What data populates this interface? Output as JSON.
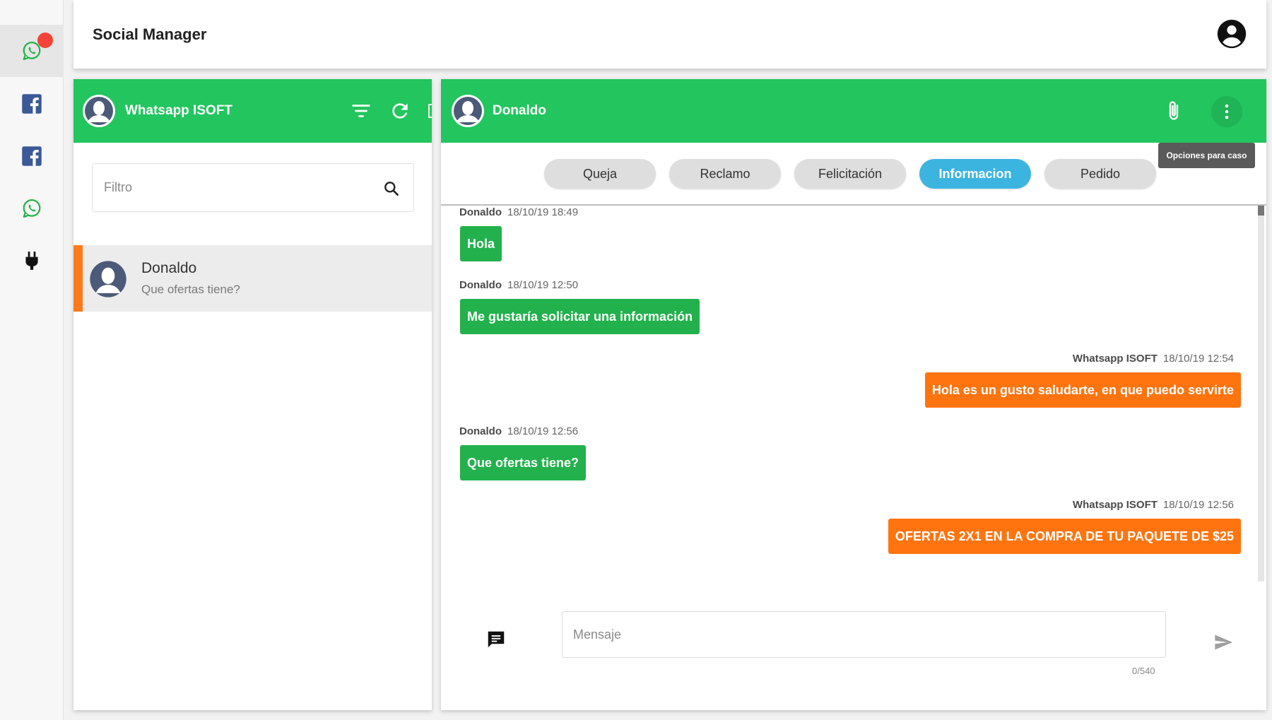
{
  "app": {
    "title": "Social Manager"
  },
  "rail": {
    "items": [
      {
        "icon": "whatsapp-icon",
        "active": true,
        "has_badge": true
      },
      {
        "icon": "facebook-icon",
        "active": false
      },
      {
        "icon": "facebook-icon",
        "active": false
      },
      {
        "icon": "whatsapp-icon",
        "active": false
      },
      {
        "icon": "plug-icon",
        "active": false
      }
    ]
  },
  "left_panel": {
    "title": "Whatsapp ISOFT",
    "filter_placeholder": "Filtro",
    "conversations": [
      {
        "name": "Donaldo",
        "preview": "Que ofertas tiene?",
        "selected": true
      }
    ]
  },
  "chat": {
    "contact": "Donaldo",
    "tooltip": "Opciones para caso",
    "categories": [
      {
        "label": "Queja",
        "active": false
      },
      {
        "label": "Reclamo",
        "active": false
      },
      {
        "label": "Felicitación",
        "active": false
      },
      {
        "label": "Informacion",
        "active": true
      },
      {
        "label": "Pedido",
        "active": false
      }
    ],
    "messages": [
      {
        "sender": "Donaldo",
        "time": "18/10/19 18:49",
        "text": "Hola",
        "direction": "in"
      },
      {
        "sender": "Donaldo",
        "time": "18/10/19 12:50",
        "text": "Me gustaría solicitar una información",
        "direction": "in"
      },
      {
        "sender": "Whatsapp ISOFT",
        "time": "18/10/19 12:54",
        "text": "Hola es un gusto saludarte, en que puedo servirte",
        "direction": "out"
      },
      {
        "sender": "Donaldo",
        "time": "18/10/19 12:56",
        "text": "Que ofertas tiene?",
        "direction": "in"
      },
      {
        "sender": "Whatsapp ISOFT",
        "time": "18/10/19 12:56",
        "text": "OFERTAS 2X1 EN LA COMPRA DE TU PAQUETE DE $25",
        "direction": "out"
      }
    ],
    "input_placeholder": "Mensaje",
    "counter": "0/540"
  },
  "colors": {
    "header_green": "#22c55e",
    "incoming_bubble": "#22b14c",
    "outgoing_bubble": "#ff740f",
    "active_category": "#3bb4e0",
    "selected_indicator": "#ff7a1a",
    "badge": "#f44336"
  }
}
